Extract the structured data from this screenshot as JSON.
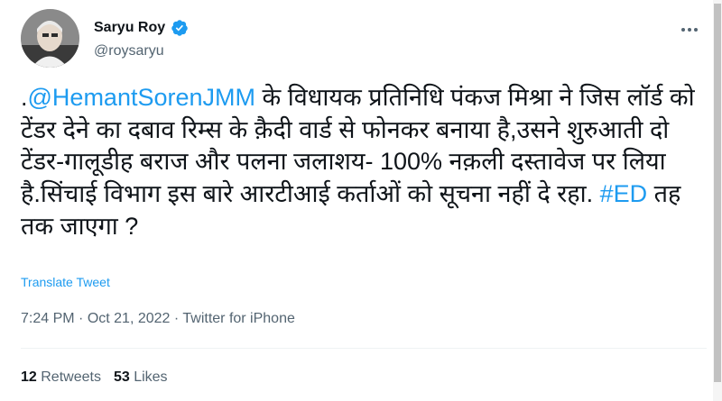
{
  "author": {
    "name": "Saryu Roy",
    "handle": "@roysaryu"
  },
  "tweet": {
    "prefix": ".",
    "mention": "@HemantSorenJMM",
    "text_1": " के विधायक प्रतिनिधि पंकज मिश्रा ने जिस लॉर्ड को टेंडर देने का दबाव रिम्स के क़ैदी वार्ड से फोनकर बनाया है,उसने शुरुआती दो टेंडर-गालूडीह बराज और पलना जलाशय- 100% नक़ली दस्तावेज पर लिया है.सिंचाई विभाग इस बारे आरटीआई कर्ताओं को सूचना नहीं दे रहा. ",
    "hashtag": "#ED",
    "text_2": " तह तक जाएगा ?"
  },
  "translate_label": "Translate Tweet",
  "meta": {
    "time": "7:24 PM",
    "sep1": " · ",
    "date": "Oct 21, 2022",
    "sep2": " · ",
    "source": "Twitter for iPhone"
  },
  "stats": {
    "retweets_count": "12",
    "retweets_label": "Retweets",
    "likes_count": "53",
    "likes_label": "Likes"
  },
  "icons": {
    "verified": "verified-badge-icon",
    "more": "more-options-icon"
  },
  "colors": {
    "link": "#1d9bf0",
    "secondary": "#536471"
  }
}
